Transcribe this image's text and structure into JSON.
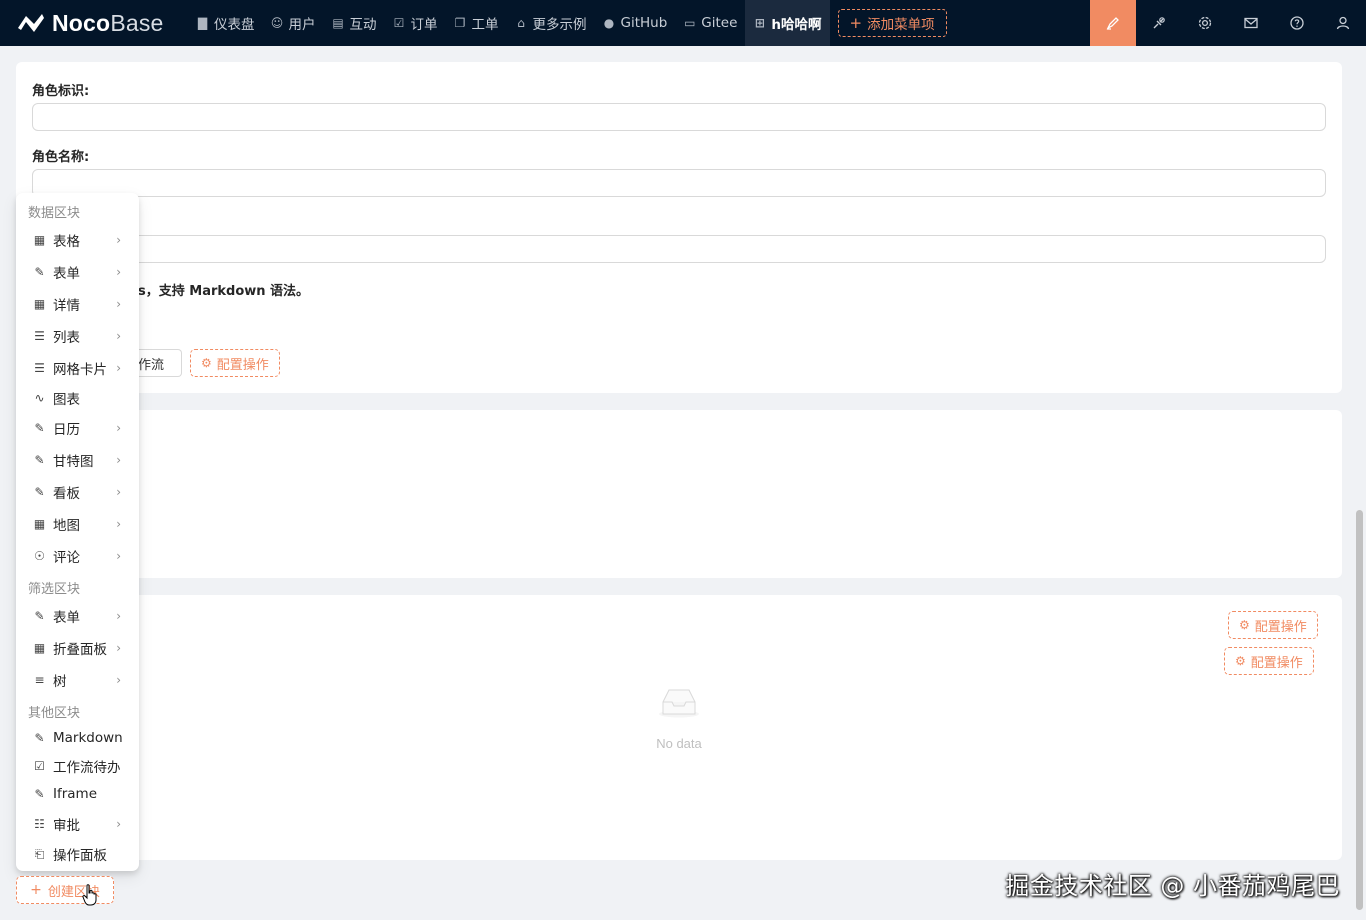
{
  "brand": {
    "bold": "Noco",
    "light": "Base"
  },
  "nav": {
    "items": [
      {
        "label": "仪表盘",
        "icon": "bar-chart-icon"
      },
      {
        "label": "用户",
        "icon": "user-icon"
      },
      {
        "label": "互动",
        "icon": "calendar-icon"
      },
      {
        "label": "订单",
        "icon": "check-square-icon"
      },
      {
        "label": "工单",
        "icon": "copy-icon"
      },
      {
        "label": "更多示例",
        "icon": "bank-icon"
      },
      {
        "label": "GitHub",
        "icon": "github-icon"
      },
      {
        "label": "Gitee",
        "icon": "laptop-icon"
      },
      {
        "label": "h哈哈啊",
        "icon": "appstore-icon",
        "active": true
      }
    ],
    "add_menu_label": "添加菜单项"
  },
  "form": {
    "role_id_label": "角色标识:",
    "role_name_label": "角色名称:",
    "help_text": "s，支持 Markdown 语法。",
    "workflow_button": "作流",
    "config_actions_label": "配置操作"
  },
  "table": {
    "config_actions_label": "配置操作",
    "config_actions_label_2": "配置操作",
    "empty_text": "No data"
  },
  "block_menu": {
    "data_group": "数据区块",
    "data_items": [
      {
        "label": "表格",
        "icon": "table-icon",
        "submenu": true
      },
      {
        "label": "表单",
        "icon": "form-icon",
        "submenu": true
      },
      {
        "label": "详情",
        "icon": "table-icon",
        "submenu": true
      },
      {
        "label": "列表",
        "icon": "list-icon",
        "submenu": true
      },
      {
        "label": "网格卡片",
        "icon": "list-icon",
        "submenu": true
      },
      {
        "label": "图表",
        "icon": "line-chart-icon",
        "submenu": false
      },
      {
        "label": "日历",
        "icon": "form-icon",
        "submenu": true
      },
      {
        "label": "甘特图",
        "icon": "form-icon",
        "submenu": true
      },
      {
        "label": "看板",
        "icon": "form-icon",
        "submenu": true
      },
      {
        "label": "地图",
        "icon": "table-icon",
        "submenu": true
      },
      {
        "label": "评论",
        "icon": "comment-icon",
        "submenu": true
      }
    ],
    "filter_group": "筛选区块",
    "filter_items": [
      {
        "label": "表单",
        "icon": "form-icon",
        "submenu": true
      },
      {
        "label": "折叠面板",
        "icon": "table-icon",
        "submenu": true
      },
      {
        "label": "树",
        "icon": "menu-icon",
        "submenu": true
      }
    ],
    "other_group": "其他区块",
    "other_items": [
      {
        "label": "Markdown",
        "icon": "form-icon",
        "submenu": false
      },
      {
        "label": "工作流待办",
        "icon": "check-square-icon",
        "submenu": false
      },
      {
        "label": "Iframe",
        "icon": "form-icon",
        "submenu": false
      },
      {
        "label": "审批",
        "icon": "audit-icon",
        "submenu": true
      },
      {
        "label": "操作面板",
        "icon": "file-icon",
        "submenu": false
      }
    ]
  },
  "create_block_label": "创建区块",
  "watermark": "掘金技术社区 @ 小番茄鸡尾巴",
  "colors": {
    "nav_bg": "#031529",
    "accent": "#f18b62",
    "page_bg": "#f0f2f5"
  }
}
